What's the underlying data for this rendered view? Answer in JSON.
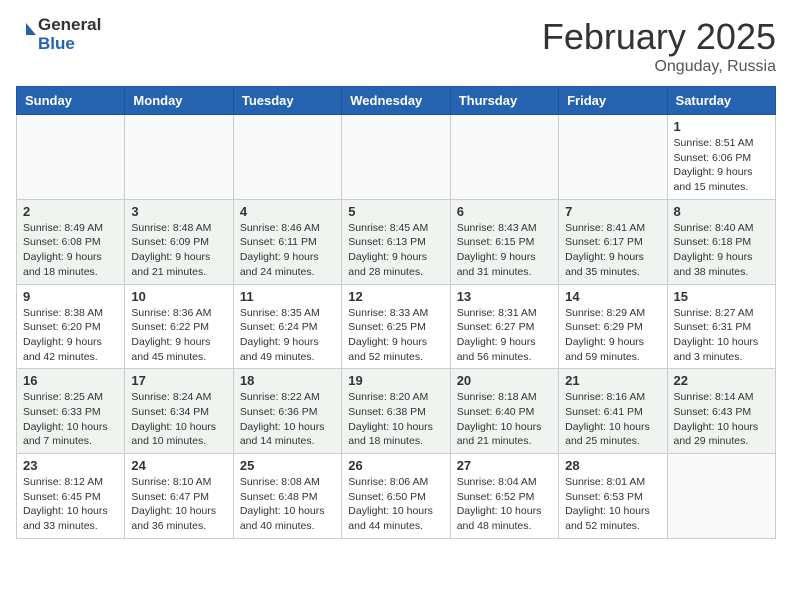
{
  "header": {
    "logo_general": "General",
    "logo_blue": "Blue",
    "month_year": "February 2025",
    "location": "Onguday, Russia"
  },
  "days_of_week": [
    "Sunday",
    "Monday",
    "Tuesday",
    "Wednesday",
    "Thursday",
    "Friday",
    "Saturday"
  ],
  "weeks": [
    {
      "alt": false,
      "days": [
        {
          "num": "",
          "info": ""
        },
        {
          "num": "",
          "info": ""
        },
        {
          "num": "",
          "info": ""
        },
        {
          "num": "",
          "info": ""
        },
        {
          "num": "",
          "info": ""
        },
        {
          "num": "",
          "info": ""
        },
        {
          "num": "1",
          "info": "Sunrise: 8:51 AM\nSunset: 6:06 PM\nDaylight: 9 hours and 15 minutes."
        }
      ]
    },
    {
      "alt": true,
      "days": [
        {
          "num": "2",
          "info": "Sunrise: 8:49 AM\nSunset: 6:08 PM\nDaylight: 9 hours and 18 minutes."
        },
        {
          "num": "3",
          "info": "Sunrise: 8:48 AM\nSunset: 6:09 PM\nDaylight: 9 hours and 21 minutes."
        },
        {
          "num": "4",
          "info": "Sunrise: 8:46 AM\nSunset: 6:11 PM\nDaylight: 9 hours and 24 minutes."
        },
        {
          "num": "5",
          "info": "Sunrise: 8:45 AM\nSunset: 6:13 PM\nDaylight: 9 hours and 28 minutes."
        },
        {
          "num": "6",
          "info": "Sunrise: 8:43 AM\nSunset: 6:15 PM\nDaylight: 9 hours and 31 minutes."
        },
        {
          "num": "7",
          "info": "Sunrise: 8:41 AM\nSunset: 6:17 PM\nDaylight: 9 hours and 35 minutes."
        },
        {
          "num": "8",
          "info": "Sunrise: 8:40 AM\nSunset: 6:18 PM\nDaylight: 9 hours and 38 minutes."
        }
      ]
    },
    {
      "alt": false,
      "days": [
        {
          "num": "9",
          "info": "Sunrise: 8:38 AM\nSunset: 6:20 PM\nDaylight: 9 hours and 42 minutes."
        },
        {
          "num": "10",
          "info": "Sunrise: 8:36 AM\nSunset: 6:22 PM\nDaylight: 9 hours and 45 minutes."
        },
        {
          "num": "11",
          "info": "Sunrise: 8:35 AM\nSunset: 6:24 PM\nDaylight: 9 hours and 49 minutes."
        },
        {
          "num": "12",
          "info": "Sunrise: 8:33 AM\nSunset: 6:25 PM\nDaylight: 9 hours and 52 minutes."
        },
        {
          "num": "13",
          "info": "Sunrise: 8:31 AM\nSunset: 6:27 PM\nDaylight: 9 hours and 56 minutes."
        },
        {
          "num": "14",
          "info": "Sunrise: 8:29 AM\nSunset: 6:29 PM\nDaylight: 9 hours and 59 minutes."
        },
        {
          "num": "15",
          "info": "Sunrise: 8:27 AM\nSunset: 6:31 PM\nDaylight: 10 hours and 3 minutes."
        }
      ]
    },
    {
      "alt": true,
      "days": [
        {
          "num": "16",
          "info": "Sunrise: 8:25 AM\nSunset: 6:33 PM\nDaylight: 10 hours and 7 minutes."
        },
        {
          "num": "17",
          "info": "Sunrise: 8:24 AM\nSunset: 6:34 PM\nDaylight: 10 hours and 10 minutes."
        },
        {
          "num": "18",
          "info": "Sunrise: 8:22 AM\nSunset: 6:36 PM\nDaylight: 10 hours and 14 minutes."
        },
        {
          "num": "19",
          "info": "Sunrise: 8:20 AM\nSunset: 6:38 PM\nDaylight: 10 hours and 18 minutes."
        },
        {
          "num": "20",
          "info": "Sunrise: 8:18 AM\nSunset: 6:40 PM\nDaylight: 10 hours and 21 minutes."
        },
        {
          "num": "21",
          "info": "Sunrise: 8:16 AM\nSunset: 6:41 PM\nDaylight: 10 hours and 25 minutes."
        },
        {
          "num": "22",
          "info": "Sunrise: 8:14 AM\nSunset: 6:43 PM\nDaylight: 10 hours and 29 minutes."
        }
      ]
    },
    {
      "alt": false,
      "days": [
        {
          "num": "23",
          "info": "Sunrise: 8:12 AM\nSunset: 6:45 PM\nDaylight: 10 hours and 33 minutes."
        },
        {
          "num": "24",
          "info": "Sunrise: 8:10 AM\nSunset: 6:47 PM\nDaylight: 10 hours and 36 minutes."
        },
        {
          "num": "25",
          "info": "Sunrise: 8:08 AM\nSunset: 6:48 PM\nDaylight: 10 hours and 40 minutes."
        },
        {
          "num": "26",
          "info": "Sunrise: 8:06 AM\nSunset: 6:50 PM\nDaylight: 10 hours and 44 minutes."
        },
        {
          "num": "27",
          "info": "Sunrise: 8:04 AM\nSunset: 6:52 PM\nDaylight: 10 hours and 48 minutes."
        },
        {
          "num": "28",
          "info": "Sunrise: 8:01 AM\nSunset: 6:53 PM\nDaylight: 10 hours and 52 minutes."
        },
        {
          "num": "",
          "info": ""
        }
      ]
    }
  ]
}
